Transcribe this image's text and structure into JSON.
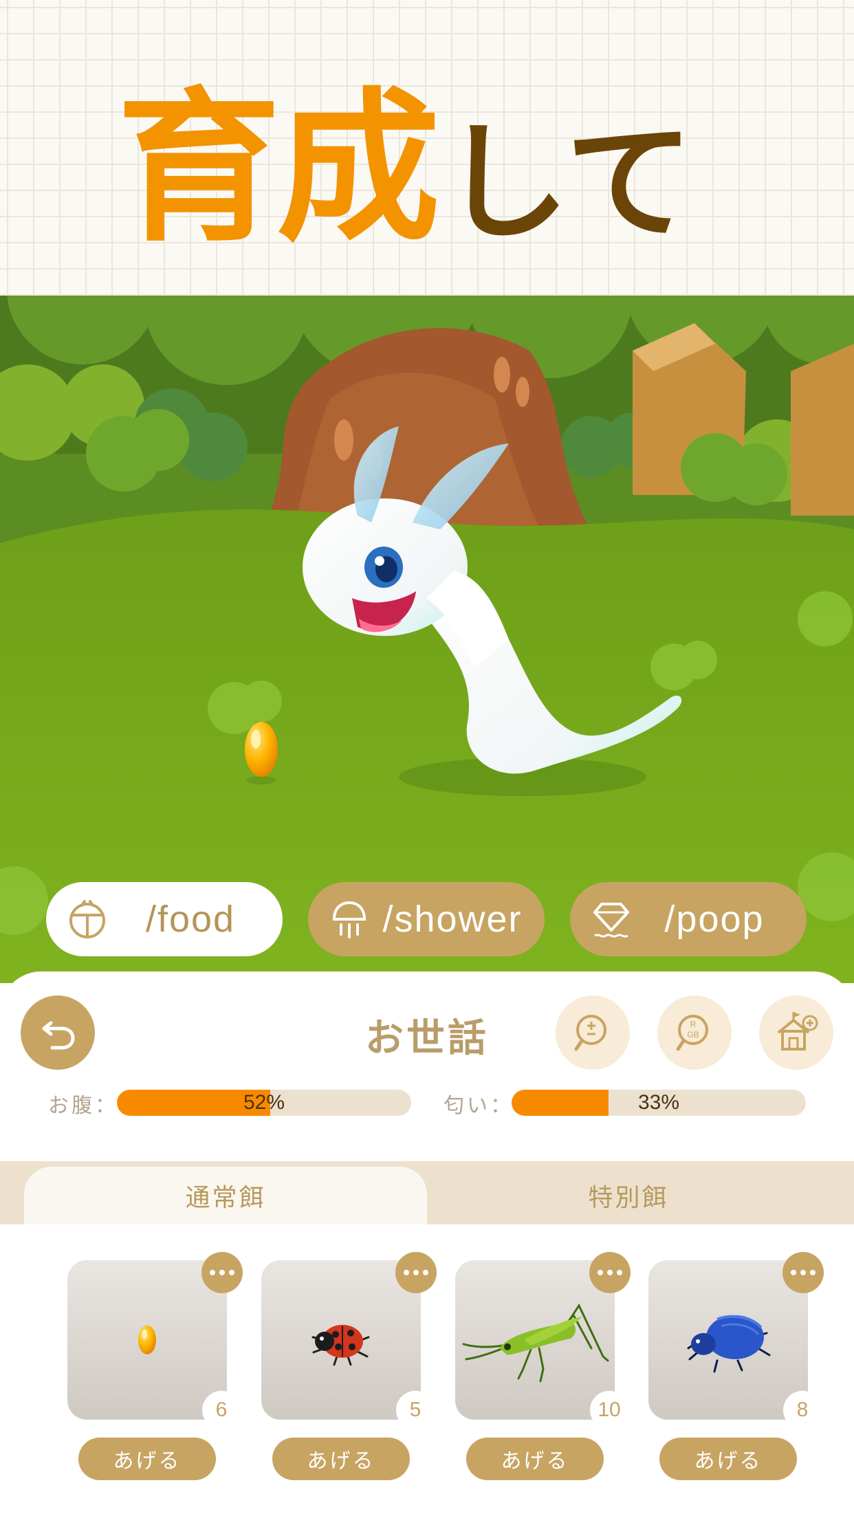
{
  "banner": {
    "title_main": "育成",
    "title_sub": "して"
  },
  "scene": {
    "icons": [
      "tree-icon",
      "creature-icon",
      "food-pellet-icon"
    ]
  },
  "actions": [
    {
      "label": "/food",
      "icon": "food-icon",
      "selected": true
    },
    {
      "label": "/shower",
      "icon": "shower-icon",
      "selected": false
    },
    {
      "label": "/poop",
      "icon": "poop-icon",
      "selected": false
    }
  ],
  "panel": {
    "title": "お世話",
    "back_icon": "back-arrow-icon",
    "tools": [
      "scale-search-icon",
      "rgb-icon",
      "house-icon"
    ],
    "stats": [
      {
        "label": "お腹：",
        "value_text": "52%",
        "fraction": 0.52
      },
      {
        "label": "匂い：",
        "value_text": "33%",
        "fraction": 0.33
      }
    ]
  },
  "tabs": [
    {
      "label": "通常餌",
      "active": true
    },
    {
      "label": "特別餌",
      "active": false
    }
  ],
  "foods": [
    {
      "icon": "pellet-icon",
      "count": "6",
      "button": "あげる"
    },
    {
      "icon": "ladybug-icon",
      "count": "5",
      "button": "あげる"
    },
    {
      "icon": "grasshopper-icon",
      "count": "10",
      "button": "あげる"
    },
    {
      "icon": "beetle-icon",
      "count": "8",
      "button": "あげる"
    }
  ],
  "colors": {
    "accent": "#f39300",
    "brown": "#6b4508",
    "gold": "#c7a462",
    "bar_fill": "#f88a00",
    "grass": "#79ad1c"
  }
}
